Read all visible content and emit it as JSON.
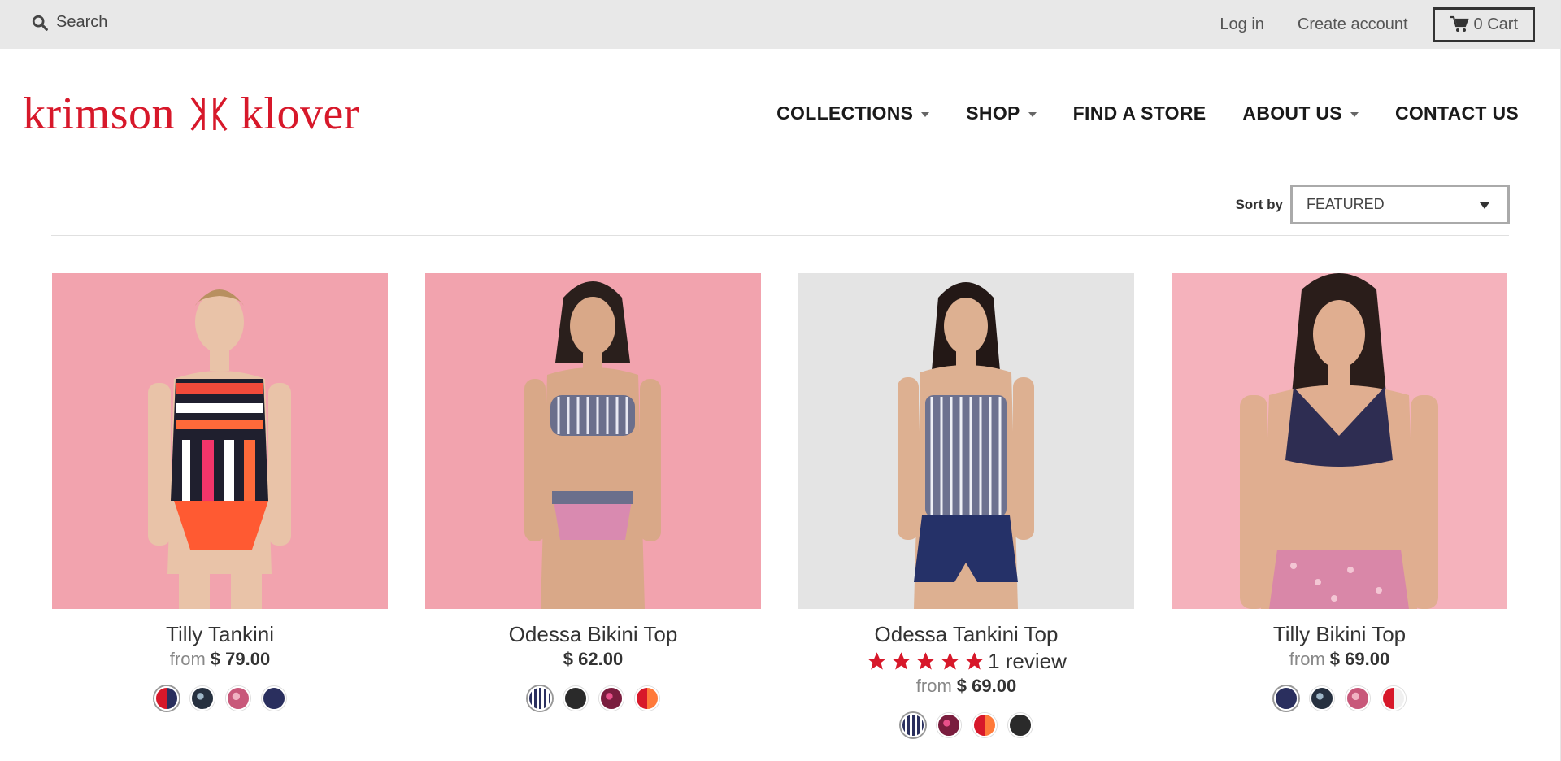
{
  "topbar": {
    "search_label": "Search",
    "login": "Log in",
    "create_account": "Create account",
    "cart": "0 Cart"
  },
  "brand": {
    "logo_text": "krimson ⅌ klover",
    "color": "#d7182a"
  },
  "nav": {
    "items": [
      {
        "label": "COLLECTIONS",
        "has_dropdown": true
      },
      {
        "label": "SHOP",
        "has_dropdown": true
      },
      {
        "label": "FIND A STORE",
        "has_dropdown": false
      },
      {
        "label": "ABOUT US",
        "has_dropdown": true
      },
      {
        "label": "CONTACT US",
        "has_dropdown": false
      }
    ]
  },
  "sort": {
    "label": "Sort by",
    "value": "FEATURED"
  },
  "products": [
    {
      "title": "Tilly Tankini",
      "from": "from",
      "price": "$ 79.00",
      "swatches": [
        "red-stripe",
        "navy-floral",
        "pink-floral",
        "navy"
      ]
    },
    {
      "title": "Odessa Bikini Top",
      "from": "",
      "price": "$ 62.00",
      "swatches": [
        "navy-stripe",
        "black",
        "magenta-floral",
        "red-stripe"
      ]
    },
    {
      "title": "Odessa Tankini Top",
      "from": "from",
      "price": "$ 69.00",
      "rating": 5,
      "reviews": "1 review",
      "swatches": [
        "navy-stripe",
        "magenta-floral",
        "red-stripe",
        "black"
      ]
    },
    {
      "title": "Tilly Bikini Top",
      "from": "from",
      "price": "$ 69.00",
      "swatches": [
        "navy",
        "navy-floral",
        "pink-floral",
        "red-stripe"
      ]
    }
  ],
  "colors": {
    "star": "#d7182a",
    "pink_bg": "#f2a3ae",
    "grey_bg": "#e4e4e4",
    "navy": "#2a2f5e"
  }
}
